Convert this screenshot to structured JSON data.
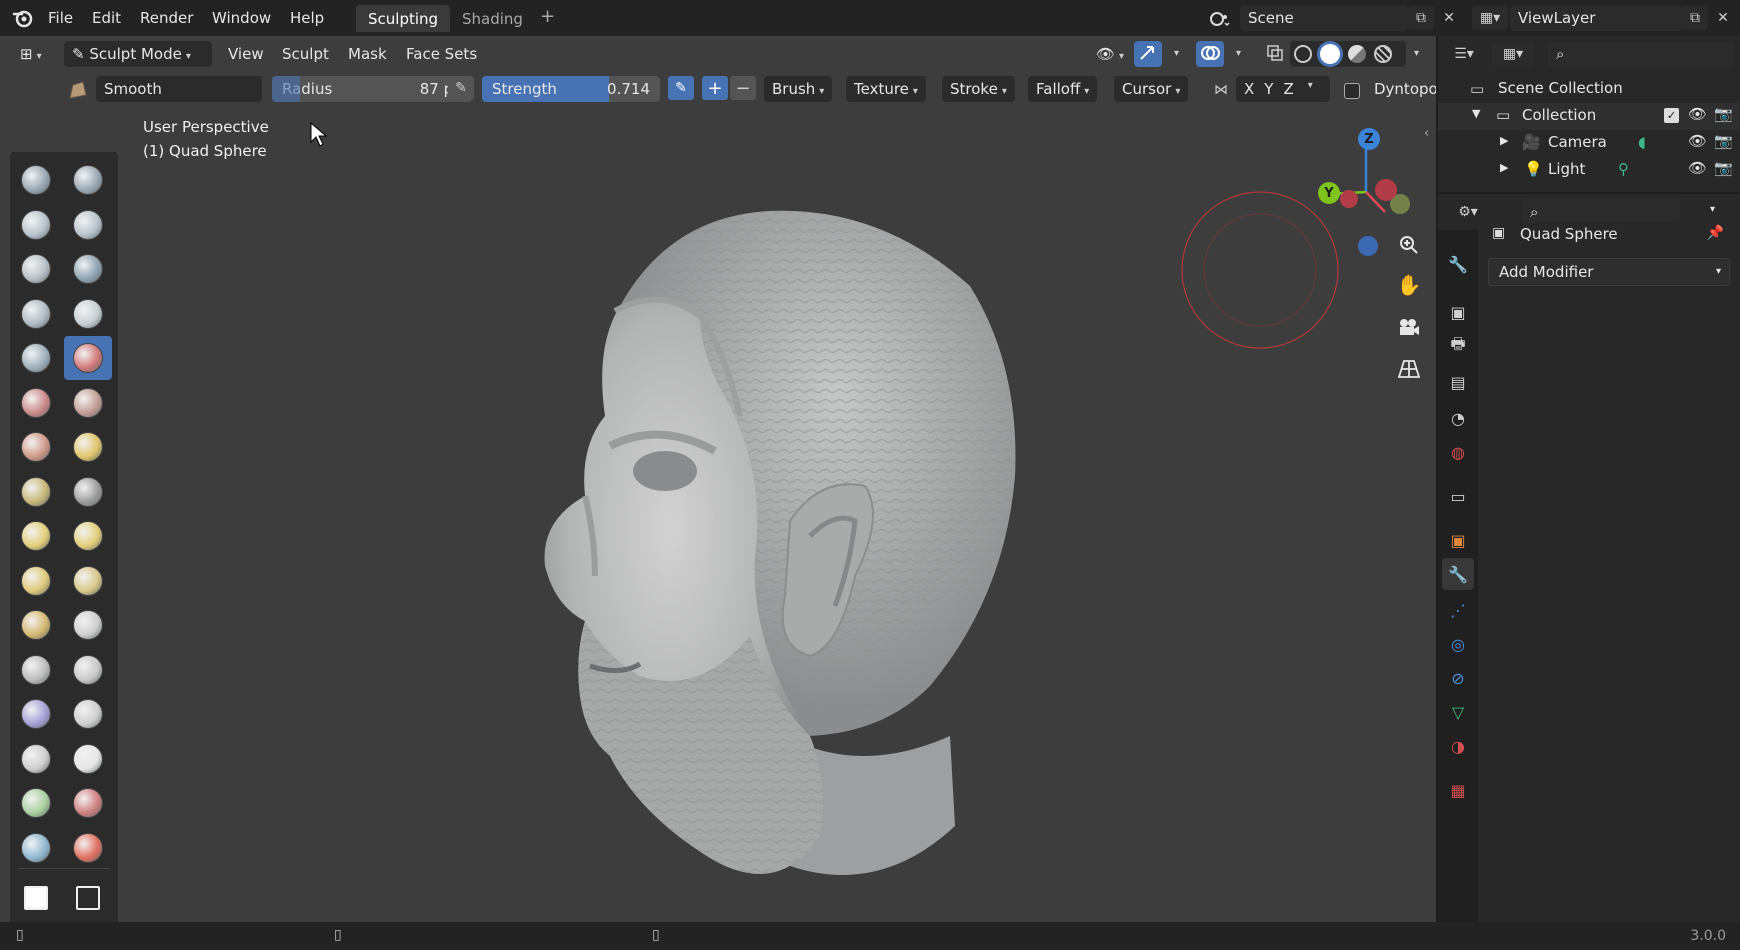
{
  "menu": {
    "file": "File",
    "edit": "Edit",
    "render": "Render",
    "window": "Window",
    "help": "Help"
  },
  "workspaces": {
    "sculpting": "Sculpting",
    "shading": "Shading",
    "add": "+"
  },
  "scene": {
    "label": "Scene"
  },
  "viewlayer": {
    "label": "ViewLayer"
  },
  "header": {
    "mode": "Sculpt Mode",
    "view": "View",
    "sculpt": "Sculpt",
    "mask": "Mask",
    "face_sets": "Face Sets"
  },
  "tool_header": {
    "brush_name": "Smooth",
    "radius_label": "Radius",
    "radius_value": "87 px",
    "strength_label": "Strength",
    "strength_value": "0.714",
    "plus": "+",
    "minus": "−",
    "brush": "Brush",
    "texture": "Texture",
    "stroke": "Stroke",
    "falloff": "Falloff",
    "cursor": "Cursor",
    "x": "X",
    "y": "Y",
    "z": "Z",
    "dyntopo": "Dyntopo"
  },
  "viewport": {
    "perspective": "User Perspective",
    "object": "(1) Quad Sphere"
  },
  "gizmo": {
    "z": "Z",
    "y": "Y"
  },
  "outliner": {
    "scene_collection": "Scene Collection",
    "collection": "Collection",
    "camera": "Camera",
    "light": "Light"
  },
  "properties": {
    "object_name": "Quad Sphere",
    "add_modifier": "Add Modifier"
  },
  "status": {
    "version": "3.0.0"
  },
  "colors": {
    "accent_blue": "#4772b3",
    "gizmo_x": "#e24a55",
    "gizmo_y": "#7fc41c",
    "gizmo_z": "#3b83d6"
  }
}
